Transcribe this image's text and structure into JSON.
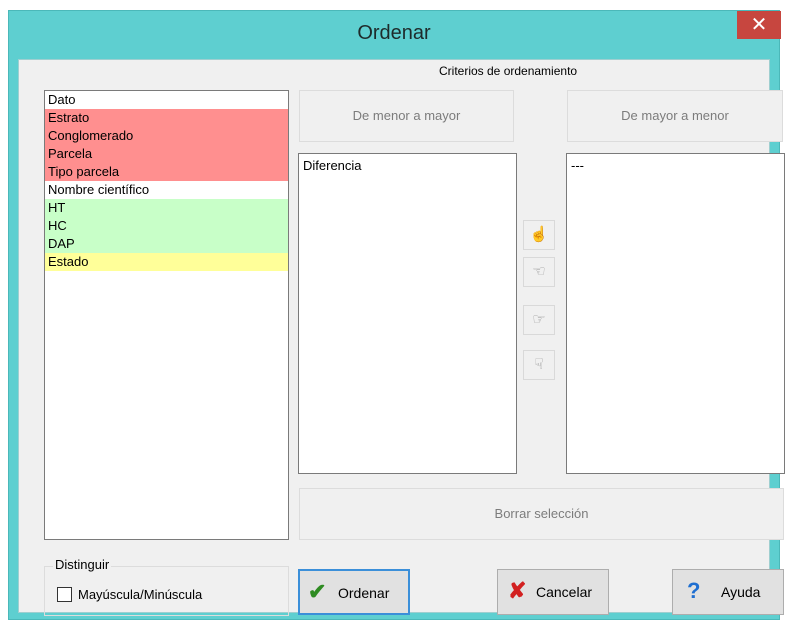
{
  "window": {
    "title": "Ordenar",
    "close_glyph": "✕"
  },
  "criteria_label": "Criterios de ordenamiento",
  "fields": [
    {
      "label": "Dato",
      "color": "#ffffff"
    },
    {
      "label": "Estrato",
      "color": "#ff8f8f"
    },
    {
      "label": "Conglomerado",
      "color": "#ff8f8f"
    },
    {
      "label": "Parcela",
      "color": "#ff8f8f"
    },
    {
      "label": "Tipo parcela",
      "color": "#ff8f8f"
    },
    {
      "label": "Nombre científico",
      "color": "#ffffff"
    },
    {
      "label": "HT",
      "color": "#c8ffc8"
    },
    {
      "label": "HC",
      "color": "#c8ffc8"
    },
    {
      "label": "DAP",
      "color": "#c8ffc8"
    },
    {
      "label": "Estado",
      "color": "#ffff99"
    }
  ],
  "ascending": {
    "button_label": "De menor a mayor",
    "items": [
      "Diferencia"
    ]
  },
  "descending": {
    "button_label": "De mayor a menor",
    "items": [
      "---"
    ]
  },
  "arrows": {
    "up": "☝",
    "left": "☜",
    "right": "☞",
    "down": "☟"
  },
  "clear_label": "Borrar selección",
  "distinguish": {
    "legend": "Distinguir",
    "checkbox_label": "Mayúscula/Minúscula",
    "checked": false
  },
  "buttons": {
    "ok": {
      "label": "Ordenar",
      "icon": "✔",
      "icon_color": "#2e8b22"
    },
    "cancel": {
      "label": "Cancelar",
      "icon": "✘",
      "icon_color": "#d22020"
    },
    "help": {
      "label": "Ayuda",
      "icon": "?",
      "icon_color": "#1f6fd1"
    }
  }
}
